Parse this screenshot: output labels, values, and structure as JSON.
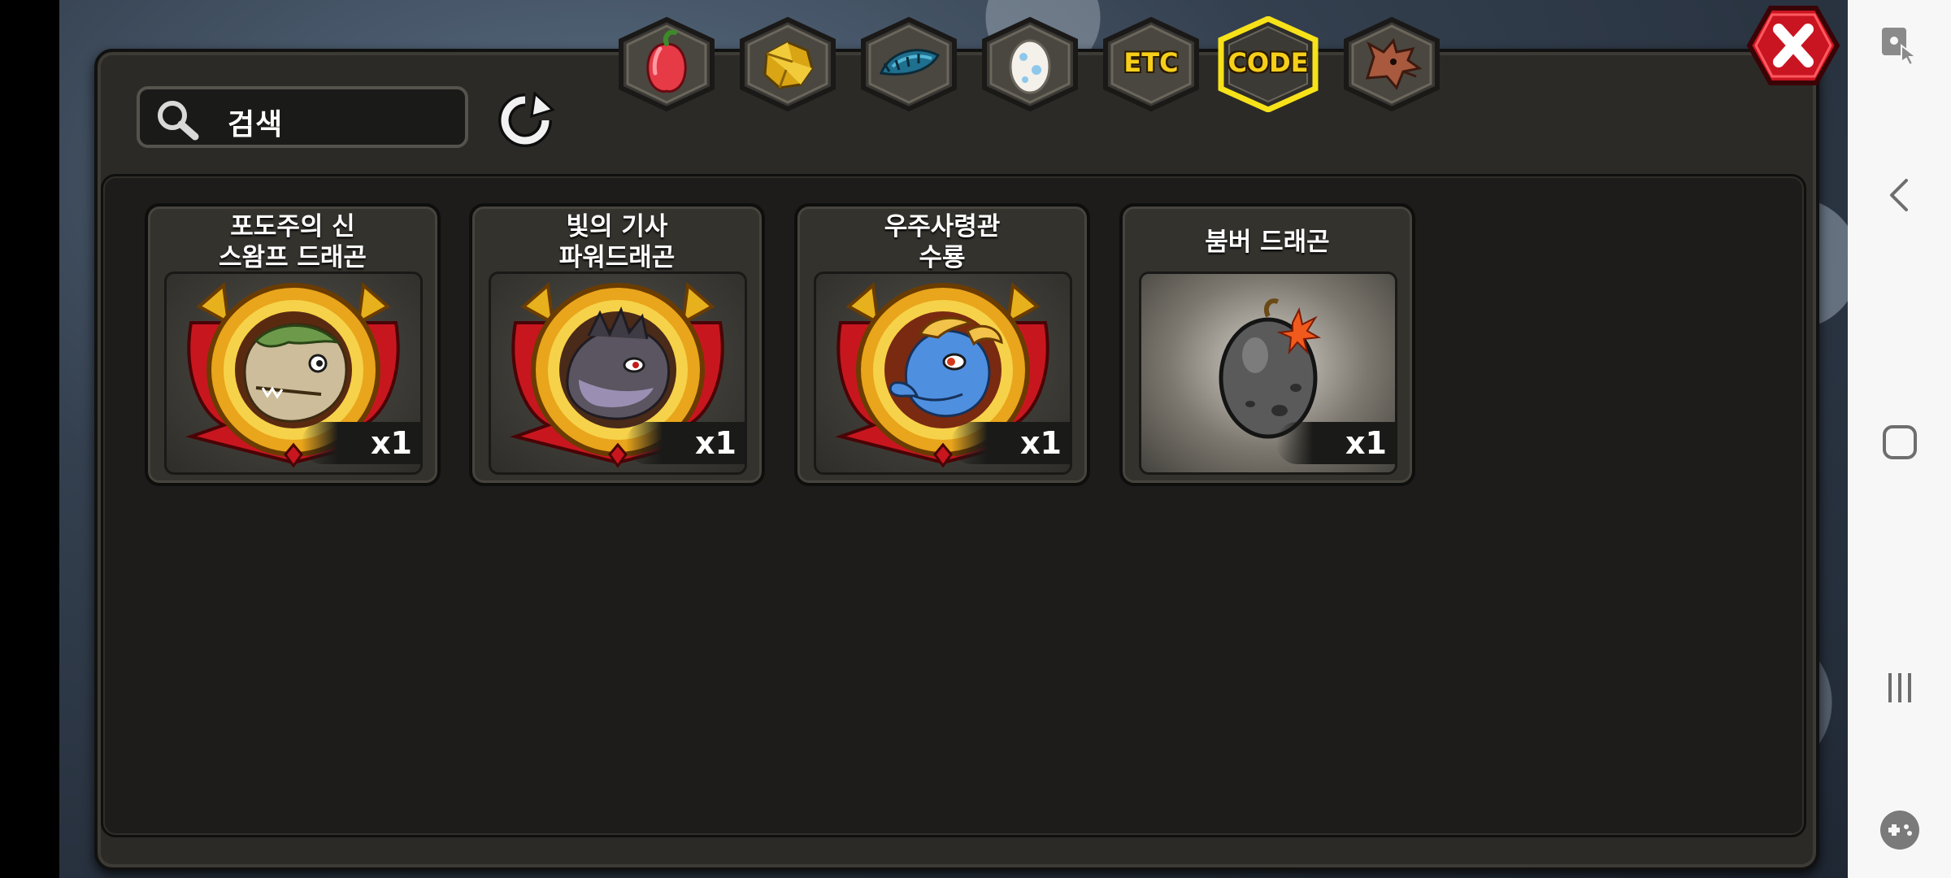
{
  "search": {
    "placeholder": "검색"
  },
  "tabs": [
    {
      "id": "fruit",
      "icon": "fruit-icon",
      "label": ""
    },
    {
      "id": "gold",
      "icon": "gold-nugget-icon",
      "label": ""
    },
    {
      "id": "dragon-scale",
      "icon": "dragon-scale-icon",
      "label": ""
    },
    {
      "id": "egg",
      "icon": "egg-icon",
      "label": ""
    },
    {
      "id": "etc",
      "icon": "",
      "label": "ETC"
    },
    {
      "id": "code",
      "icon": "",
      "label": "CODE",
      "selected": true
    },
    {
      "id": "dragon-head",
      "icon": "dragon-head-icon",
      "label": ""
    }
  ],
  "items": [
    {
      "name": "포도주의 신\n스왐프 드래곤",
      "quantity": "x1",
      "icon": "swamp-dragon-medal"
    },
    {
      "name": "빛의 기사\n파워드래곤",
      "quantity": "x1",
      "icon": "power-dragon-medal"
    },
    {
      "name": "우주사령관\n수룡",
      "quantity": "x1",
      "icon": "water-dragon-medal"
    },
    {
      "name": "붐버 드래곤",
      "quantity": "x1",
      "icon": "bomber-egg"
    }
  ],
  "colors": {
    "tab_selected_border": "#f7e21a",
    "tab_label": "#f6cf1a",
    "close_button": "#c91521",
    "panel_bg": "#2b2a26",
    "inner_bg": "#1d1c1a"
  }
}
